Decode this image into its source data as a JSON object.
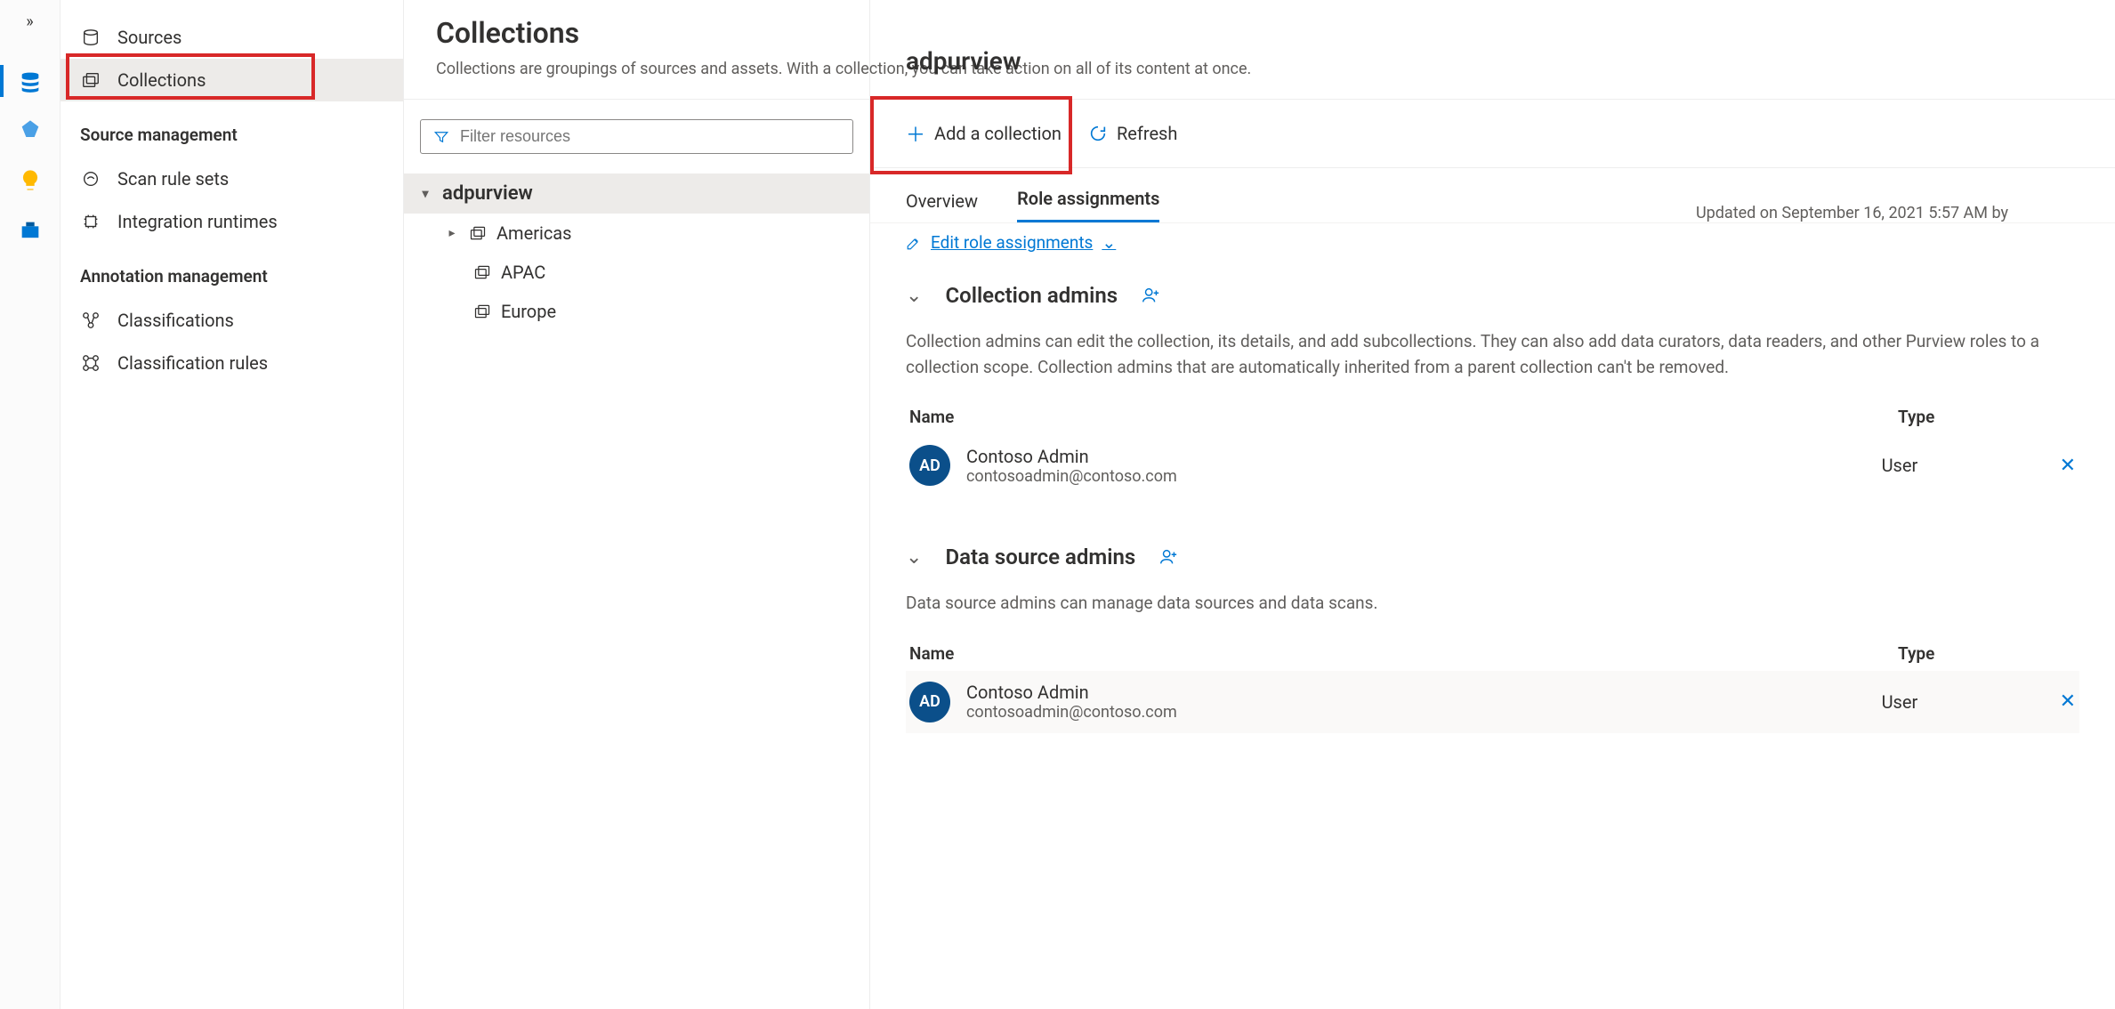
{
  "rail": {},
  "sidebar": {
    "items": [
      {
        "label": "Sources"
      },
      {
        "label": "Collections"
      }
    ],
    "section_source_mgmt": "Source management",
    "section_items": [
      {
        "label": "Scan rule sets"
      },
      {
        "label": "Integration runtimes"
      }
    ],
    "section_annotation": "Annotation management",
    "annotation_items": [
      {
        "label": "Classifications"
      },
      {
        "label": "Classification rules"
      }
    ]
  },
  "tree_header": {
    "title": "Collections",
    "subtitle": "Collections are groupings of sources and assets. With a collection, you can take action on all of its content at once.",
    "filter_placeholder": "Filter resources"
  },
  "tree": {
    "root": "adpurview",
    "children": [
      {
        "label": "Americas",
        "expandable": true
      },
      {
        "label": "APAC",
        "expandable": false
      },
      {
        "label": "Europe",
        "expandable": false
      }
    ]
  },
  "main": {
    "title": "adpurview",
    "add_collection": "Add a collection",
    "refresh": "Refresh",
    "tabs": {
      "overview": "Overview",
      "role_assignments": "Role assignments"
    },
    "updated_on": "Updated on September 16, 2021 5:57 AM by",
    "edit_roles": "Edit role assignments",
    "columns": {
      "name": "Name",
      "type": "Type"
    },
    "sections": [
      {
        "title": "Collection admins",
        "desc": "Collection admins can edit the collection, its details, and add subcollections. They can also add data curators, data readers, and other Purview roles to a collection scope. Collection admins that are automatically inherited from a parent collection can't be removed.",
        "rows": [
          {
            "avatar": "AD",
            "name": "Contoso Admin",
            "email": "contosoadmin@contoso.com",
            "type": "User"
          }
        ]
      },
      {
        "title": "Data source admins",
        "desc": "Data source admins can manage data sources and data scans.",
        "rows": [
          {
            "avatar": "AD",
            "name": "Contoso Admin",
            "email": "contosoadmin@contoso.com",
            "type": "User"
          }
        ]
      }
    ]
  }
}
